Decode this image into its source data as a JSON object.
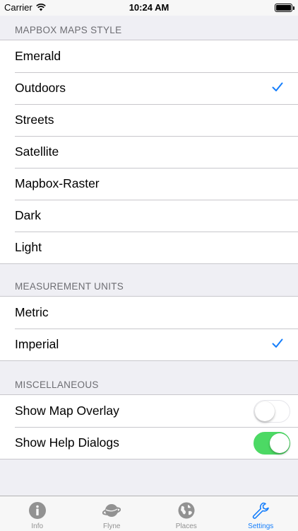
{
  "status_bar": {
    "carrier": "Carrier",
    "time": "10:24 AM"
  },
  "sections": {
    "map_style": {
      "header": "MAPBOX MAPS STYLE",
      "items": [
        "Emerald",
        "Outdoors",
        "Streets",
        "Satellite",
        "Mapbox-Raster",
        "Dark",
        "Light"
      ],
      "selected": "Outdoors"
    },
    "units": {
      "header": "MEASUREMENT UNITS",
      "items": [
        "Metric",
        "Imperial"
      ],
      "selected": "Imperial"
    },
    "misc": {
      "header": "MISCELLANEOUS",
      "items": [
        {
          "label": "Show Map Overlay",
          "on": false
        },
        {
          "label": "Show Help Dialogs",
          "on": true
        }
      ]
    }
  },
  "tabs": [
    {
      "label": "Info",
      "icon": "info-icon",
      "active": false
    },
    {
      "label": "Flyne",
      "icon": "planet-icon",
      "active": false
    },
    {
      "label": "Places",
      "icon": "globe-icon",
      "active": false
    },
    {
      "label": "Settings",
      "icon": "wrench-icon",
      "active": true
    }
  ],
  "colors": {
    "accent": "#157efb",
    "toggle_on": "#4cd964",
    "inactive_tab": "#929292",
    "background": "#efeff4"
  }
}
